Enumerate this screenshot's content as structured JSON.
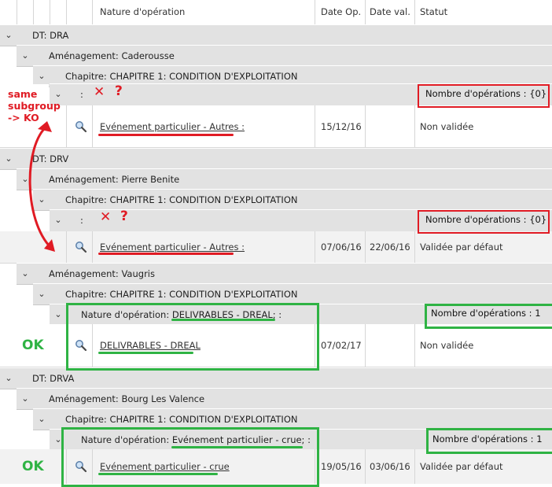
{
  "header": {
    "col_nature": "Nature d'opération",
    "col_date_op": "Date Op.",
    "col_date_val": "Date val.",
    "col_statut": "Statut"
  },
  "groups": {
    "dt_dra": "DT: DRA",
    "amg_caderousse": "Aménagement: Caderousse",
    "chap_1": "Chapitre: CHAPITRE 1: CONDITION D'EXPLOITATION",
    "sub_1": ":",
    "count_1": "Nombre d'opérations : {0}",
    "dt_drv": "DT: DRV",
    "amg_pierre": "Aménagement: Pierre Benite",
    "chap_2": "Chapitre: CHAPITRE 1: CONDITION D'EXPLOITATION",
    "sub_2": ":",
    "count_2": "Nombre d'opérations : {0}",
    "amg_vaugris": "Aménagement: Vaugris",
    "chap_3": "Chapitre: CHAPITRE 1: CONDITION D'EXPLOITATION",
    "sub_3_prefix": "Nature d'opération: ",
    "sub_3_value": "DELIVRABLES - DREAL; :",
    "count_3": "Nombre d'opérations : 1",
    "dt_drva": "DT: DRVA",
    "amg_bourg": "Aménagement: Bourg Les Valence",
    "chap_4": "Chapitre: CHAPITRE 1: CONDITION D'EXPLOITATION",
    "sub_4_prefix": "Nature d'opération: ",
    "sub_4_value": "Evénement particulier - crue; :",
    "count_4": "Nombre d'opérations : 1"
  },
  "rows": [
    {
      "nature": "Evénement particulier - Autres :",
      "date_op": "15/12/16",
      "date_val": "",
      "statut": "Non validée"
    },
    {
      "nature": "Evénement particulier - Autres :",
      "date_op": "07/06/16",
      "date_val": "22/06/16",
      "statut": "Validée par défaut"
    },
    {
      "nature": "DELIVRABLES - DREAL",
      "date_op": "07/02/17",
      "date_val": "",
      "statut": "Non validée"
    },
    {
      "nature": "Evénement particulier - crue",
      "date_op": "19/05/16",
      "date_val": "03/06/16",
      "statut": "Validée par défaut"
    }
  ],
  "annotations": {
    "ko_line1": "same",
    "ko_line2": "subgroup",
    "ko_line3": "-> KO",
    "ok1": "OK",
    "ok2": "OK",
    "cross": "✕",
    "question": "?"
  },
  "colors": {
    "annotation_red": "#e01b24",
    "annotation_green": "#2fb344",
    "group_bg": "#e2e2e2"
  },
  "icons": [
    "chevron-down-icon",
    "magnifier-icon",
    "cross-icon",
    "curved-arrow-icon"
  ]
}
